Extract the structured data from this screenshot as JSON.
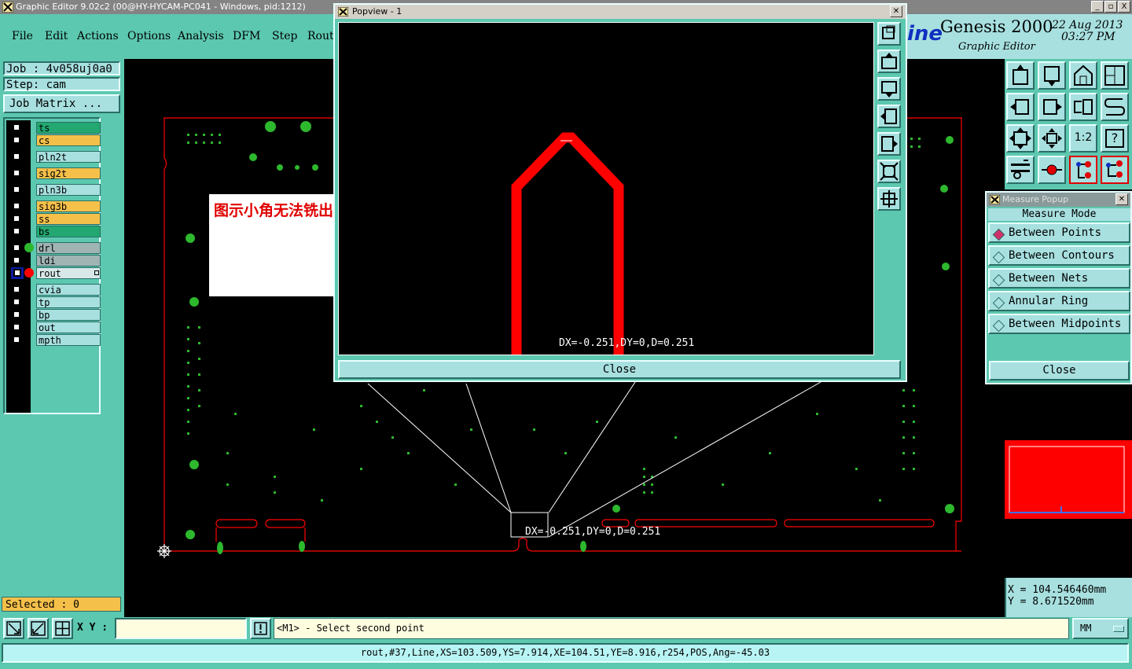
{
  "window": {
    "title": "Graphic Editor 9.02c2 (00@HY-HYCAM-PC041 - Windows, pid:1212)",
    "buttons": [
      "_",
      "▫",
      "X"
    ]
  },
  "menu": [
    "File",
    "Edit",
    "Actions",
    "Options",
    "Analysis",
    "DFM",
    "Step",
    "Rout"
  ],
  "brand": {
    "logo_fragment": "ine",
    "product": "Genesis 2000",
    "subtitle": "Graphic Editor",
    "date": "22 Aug 2013",
    "time": "03:27 PM"
  },
  "job": {
    "job_label": "Job : 4v058uj0a0",
    "step_label": "Step: cam",
    "matrix_button": "Job Matrix ..."
  },
  "layers": {
    "group1": [
      {
        "name": "ts",
        "color": "#22a870"
      },
      {
        "name": "cs",
        "color": "#f5c04a"
      },
      {
        "name": "pln2t",
        "color": "#a8e0e0"
      },
      {
        "name": "sig2t",
        "color": "#f5c04a"
      },
      {
        "name": "pln3b",
        "color": "#a8e0e0"
      }
    ],
    "group2": [
      {
        "name": "sig3b",
        "color": "#f5c04a"
      },
      {
        "name": "ss",
        "color": "#f5c04a"
      },
      {
        "name": "bs",
        "color": "#22a870"
      }
    ],
    "group3": [
      {
        "name": "drl",
        "color": "#a0b4b4"
      },
      {
        "name": "ldi",
        "color": "#a0b4b4"
      },
      {
        "name": "rout",
        "color": "#d8e8e8"
      }
    ],
    "group4": [
      {
        "name": "cvia",
        "color": "#a8e0e0"
      },
      {
        "name": "tp",
        "color": "#a8e0e0"
      },
      {
        "name": "bp",
        "color": "#a8e0e0"
      },
      {
        "name": "out",
        "color": "#a8e0e0"
      },
      {
        "name": "mpth",
        "color": "#a8e0e0"
      }
    ]
  },
  "selected": "Selected : 0",
  "note": "图示小角无法铣出，请优化",
  "canvas_measure": "DX=-0.251,DY=0,D=0.251",
  "popview": {
    "title": "Popview - 1",
    "measure": "DX=-0.251,DY=0,D=0.251",
    "close": "Close"
  },
  "measure_popup": {
    "title": "Measure Popup",
    "heading": "Measure Mode",
    "options": [
      "Between Points",
      "Between Contours",
      "Between Nets",
      "Annular Ring",
      "Between Midpoints"
    ],
    "close": "Close"
  },
  "toolbar_labels": {
    "one_to_two": "1:2",
    "help": "?"
  },
  "coords": {
    "x": "X  =  104.546460mm",
    "y": "Y  =  8.671520mm"
  },
  "bottom": {
    "xy_label": "X Y :",
    "xy_value": "",
    "prompt": "<M1> - Select second point",
    "units": "MM",
    "status": "rout,#37,Line,XS=103.509,YS=7.914,XE=104.51,YE=8.916,r254,POS,Ang=-45.03"
  },
  "colors": {
    "panel": "#5cc8b0",
    "panel_light": "#a8e0e0",
    "rout": "#ff0000",
    "copper": "#2db82d"
  }
}
